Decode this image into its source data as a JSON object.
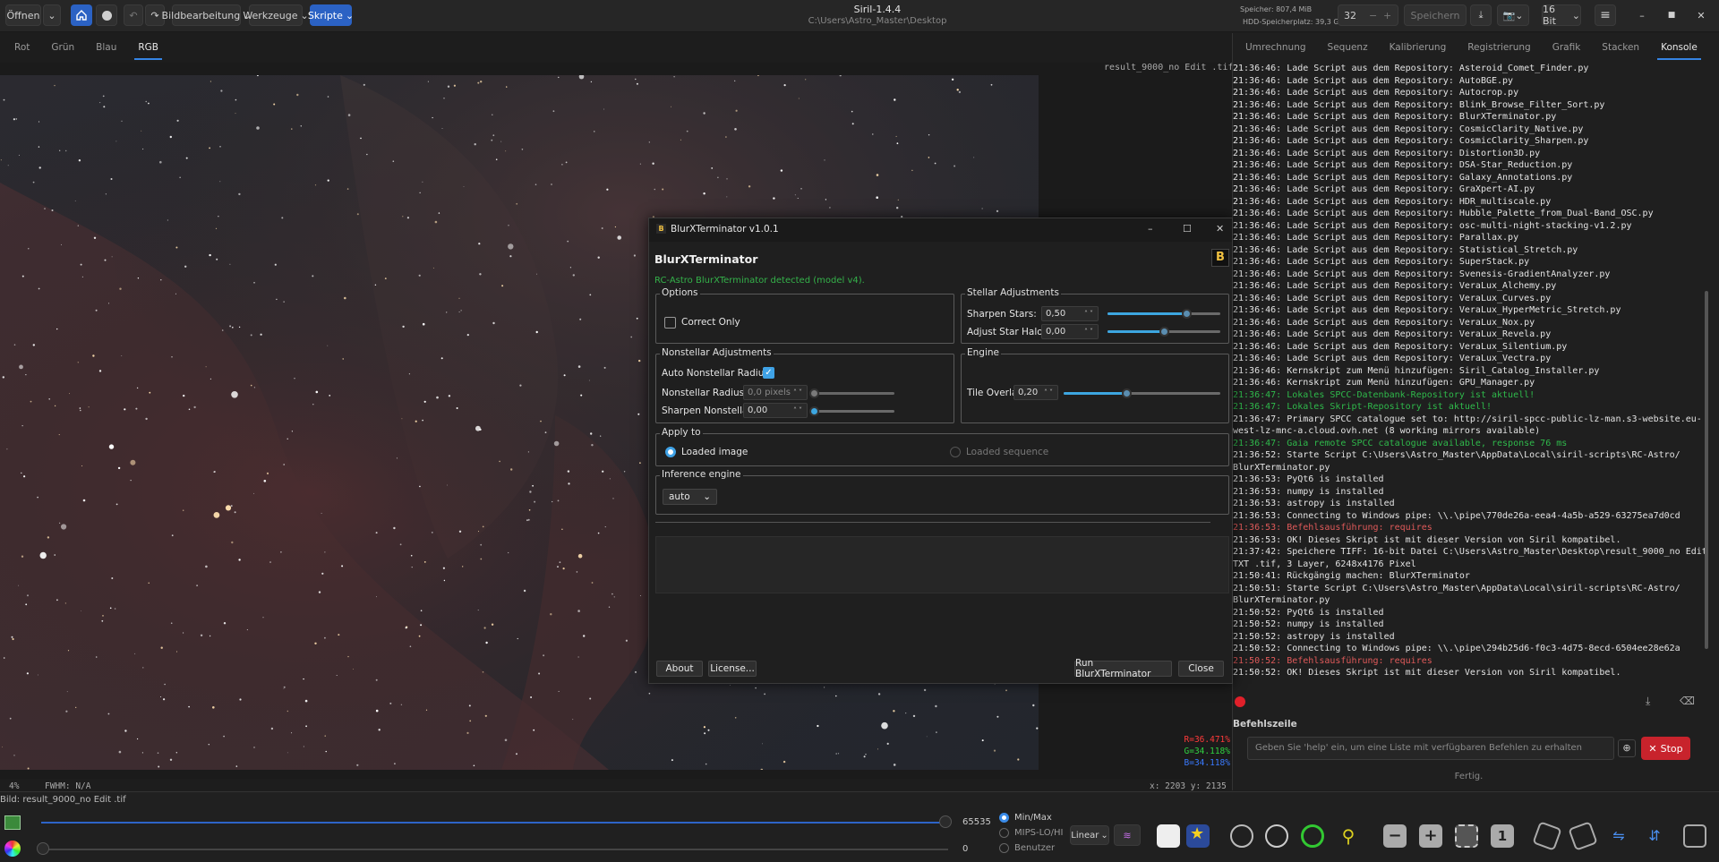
{
  "header": {
    "open_label": "Öffnen",
    "image_processing": "Bildbearbeitung",
    "tools": "Werkzeuge",
    "scripts": "Skripte",
    "app_title": "Siril-1.4.4",
    "path": "C:\\Users\\Astro_Master\\Desktop",
    "memory": "Speicher: 807,4 MiB",
    "disk": "HDD-Speicherplatz: 39,3 GiB",
    "threads": "32",
    "save": "Speichern",
    "bitdepth": "16 Bit"
  },
  "channel_tabs": [
    "Rot",
    "Grün",
    "Blau",
    "RGB"
  ],
  "right_tabs": [
    "Umrechnung",
    "Sequenz",
    "Kalibrierung",
    "Registrierung",
    "Grafik",
    "Stacken",
    "Konsole"
  ],
  "image": {
    "filename_overlay": "result_9000_no Edit .tif",
    "rgb_r": "R=36.471%",
    "rgb_g": "G=34.118%",
    "rgb_b": "B=34.118%",
    "zoom": "4%",
    "fwhm": "FWHM: N/A",
    "coords": "x: 2203  y: 2135",
    "status_file": "Bild: result_9000_no Edit .tif"
  },
  "console_lines": [
    {
      "t": "21:36:46: Lade Script aus dem Repository: Asteroid_Comet_Finder.py",
      "c": ""
    },
    {
      "t": "21:36:46: Lade Script aus dem Repository: AutoBGE.py",
      "c": ""
    },
    {
      "t": "21:36:46: Lade Script aus dem Repository: Autocrop.py",
      "c": ""
    },
    {
      "t": "21:36:46: Lade Script aus dem Repository: Blink_Browse_Filter_Sort.py",
      "c": ""
    },
    {
      "t": "21:36:46: Lade Script aus dem Repository: BlurXTerminator.py",
      "c": ""
    },
    {
      "t": "21:36:46: Lade Script aus dem Repository: CosmicClarity_Native.py",
      "c": ""
    },
    {
      "t": "21:36:46: Lade Script aus dem Repository: CosmicClarity_Sharpen.py",
      "c": ""
    },
    {
      "t": "21:36:46: Lade Script aus dem Repository: Distortion3D.py",
      "c": ""
    },
    {
      "t": "21:36:46: Lade Script aus dem Repository: DSA-Star_Reduction.py",
      "c": ""
    },
    {
      "t": "21:36:46: Lade Script aus dem Repository: Galaxy_Annotations.py",
      "c": ""
    },
    {
      "t": "21:36:46: Lade Script aus dem Repository: GraXpert-AI.py",
      "c": ""
    },
    {
      "t": "21:36:46: Lade Script aus dem Repository: HDR_multiscale.py",
      "c": ""
    },
    {
      "t": "21:36:46: Lade Script aus dem Repository: Hubble_Palette_from_Dual-Band_OSC.py",
      "c": ""
    },
    {
      "t": "21:36:46: Lade Script aus dem Repository: osc-multi-night-stacking-v1.2.py",
      "c": ""
    },
    {
      "t": "21:36:46: Lade Script aus dem Repository: Parallax.py",
      "c": ""
    },
    {
      "t": "21:36:46: Lade Script aus dem Repository: Statistical_Stretch.py",
      "c": ""
    },
    {
      "t": "21:36:46: Lade Script aus dem Repository: SuperStack.py",
      "c": ""
    },
    {
      "t": "21:36:46: Lade Script aus dem Repository: Svenesis-GradientAnalyzer.py",
      "c": ""
    },
    {
      "t": "21:36:46: Lade Script aus dem Repository: VeraLux_Alchemy.py",
      "c": ""
    },
    {
      "t": "21:36:46: Lade Script aus dem Repository: VeraLux_Curves.py",
      "c": ""
    },
    {
      "t": "21:36:46: Lade Script aus dem Repository: VeraLux_HyperMetric_Stretch.py",
      "c": ""
    },
    {
      "t": "21:36:46: Lade Script aus dem Repository: VeraLux_Nox.py",
      "c": ""
    },
    {
      "t": "21:36:46: Lade Script aus dem Repository: VeraLux_Revela.py",
      "c": ""
    },
    {
      "t": "21:36:46: Lade Script aus dem Repository: VeraLux_Silentium.py",
      "c": ""
    },
    {
      "t": "21:36:46: Lade Script aus dem Repository: VeraLux_Vectra.py",
      "c": ""
    },
    {
      "t": "21:36:46: Kernskript zum Menü hinzufügen: Siril_Catalog_Installer.py",
      "c": ""
    },
    {
      "t": "21:36:46: Kernskript zum Menü hinzufügen: GPU_Manager.py",
      "c": ""
    },
    {
      "t": "21:36:47: Lokales SPCC-Datenbank-Repository ist aktuell!",
      "c": "g"
    },
    {
      "t": "21:36:47: Lokales Skript-Repository ist aktuell!",
      "c": "g"
    },
    {
      "t": "21:36:47: Primary SPCC catalogue set to: http://siril-spcc-public-lz-man.s3-website.eu-",
      "c": ""
    },
    {
      "t": "west-lz-mnc-a.cloud.ovh.net (8 working mirrors available)",
      "c": ""
    },
    {
      "t": "21:36:47: Gaia remote SPCC catalogue available, response 76 ms",
      "c": "g"
    },
    {
      "t": "21:36:52: Starte Script C:\\Users\\Astro_Master\\AppData\\Local\\siril-scripts\\RC-Astro/",
      "c": ""
    },
    {
      "t": "BlurXTerminator.py",
      "c": ""
    },
    {
      "t": "21:36:53: PyQt6 is installed",
      "c": ""
    },
    {
      "t": "21:36:53: numpy is installed",
      "c": ""
    },
    {
      "t": "21:36:53: astropy is installed",
      "c": ""
    },
    {
      "t": "21:36:53: Connecting to Windows pipe: \\\\.\\pipe\\770de26a-eea4-4a5b-a529-63275ea7d0cd",
      "c": ""
    },
    {
      "t": "21:36:53: Befehlsausführung: requires",
      "c": "r"
    },
    {
      "t": "21:36:53: OK! Dieses Skript ist mit dieser Version von Siril kompatibel.",
      "c": ""
    },
    {
      "t": "21:37:42: Speichere TIFF: 16-bit Datei C:\\Users\\Astro_Master\\Desktop\\result_9000_no Edit",
      "c": ""
    },
    {
      "t": "TXT .tif, 3 Layer, 6248x4176 Pixel",
      "c": ""
    },
    {
      "t": "21:50:41: Rückgängig machen: BlurXTerminator",
      "c": ""
    },
    {
      "t": "21:50:51: Starte Script C:\\Users\\Astro_Master\\AppData\\Local\\siril-scripts\\RC-Astro/",
      "c": ""
    },
    {
      "t": "BlurXTerminator.py",
      "c": ""
    },
    {
      "t": "21:50:52: PyQt6 is installed",
      "c": ""
    },
    {
      "t": "21:50:52: numpy is installed",
      "c": ""
    },
    {
      "t": "21:50:52: astropy is installed",
      "c": ""
    },
    {
      "t": "21:50:52: Connecting to Windows pipe: \\\\.\\pipe\\294b25d6-f0c3-4d75-8ecd-6504ee28e62a",
      "c": ""
    },
    {
      "t": "21:50:52: Befehlsausführung: requires",
      "c": "r"
    },
    {
      "t": "21:50:52: OK! Dieses Skript ist mit dieser Version von Siril kompatibel.",
      "c": ""
    }
  ],
  "command": {
    "label": "Befehlszeile",
    "placeholder": "Geben Sie 'help' ein, um eine Liste mit verfügbaren Befehlen zu erhalten",
    "stop": "Stop",
    "status": "Fertig."
  },
  "bottom": {
    "max_value": "65535",
    "min_value": "0",
    "minmax": "Min/Max",
    "mips": "MIPS-LO/HI",
    "user": "Benutzer",
    "scale": "Linear"
  },
  "dialog": {
    "title": "BlurXTerminator v1.0.1",
    "heading": "BlurXTerminator",
    "logo": "B",
    "detected": "RC-Astro BlurXTerminator detected (model v4).",
    "options_title": "Options",
    "correct_only": "Correct Only",
    "stellar_title": "Stellar Adjustments",
    "sharpen_stars": "Sharpen Stars:",
    "sharpen_stars_val": "0,50",
    "sharpen_stars_frac": 0.7,
    "adjust_halos": "Adjust Star Halos:",
    "adjust_halos_val": "0,00",
    "adjust_halos_frac": 0.5,
    "nonstellar_title": "Nonstellar Adjustments",
    "auto_radius": "Auto Nonstellar Radius:",
    "radius_label": "Nonstellar Radius:",
    "radius_val": "0,0 pixels",
    "sharpen_nonstellar": "Sharpen Nonstellar:",
    "sharpen_nonstellar_val": "0,00",
    "engine_title": "Engine",
    "tile_overlap": "Tile Overlap:",
    "tile_overlap_val": "0,20",
    "tile_overlap_frac": 0.4,
    "apply_title": "Apply to",
    "loaded_image": "Loaded image",
    "loaded_sequence": "Loaded sequence",
    "inference_title": "Inference engine",
    "inference_val": "auto",
    "about": "About",
    "license": "License...",
    "run": "Run BlurXTerminator",
    "close": "Close"
  }
}
